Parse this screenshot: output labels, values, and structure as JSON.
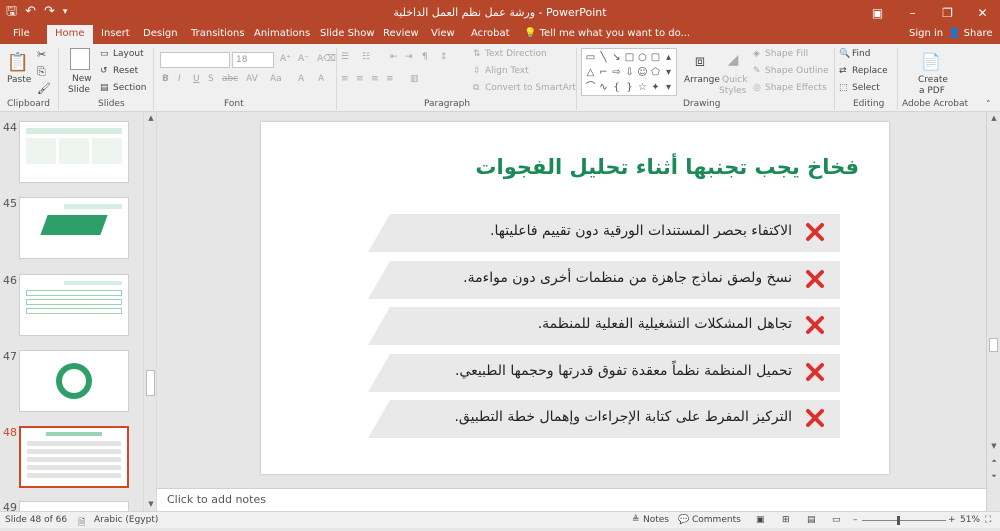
{
  "app": {
    "window_title": "ورشة عمل نظم العمل الداخلية  -  PowerPoint",
    "accent": "#b7472a"
  },
  "qat": {
    "save_icon": "save-icon",
    "undo_icon": "undo-icon",
    "redo_icon": "redo-icon",
    "customize_icon": "customize-icon"
  },
  "window_controls": {
    "ribbon_options": "▣",
    "minimize": "–",
    "restore": "❐",
    "close": "✕"
  },
  "tabs": [
    "File",
    "Home",
    "Insert",
    "Design",
    "Transitions",
    "Animations",
    "Slide Show",
    "Review",
    "View",
    "Acrobat"
  ],
  "tell_me": "Tell me what you want to do...",
  "account": {
    "sign_in": "Sign in",
    "share": "Share"
  },
  "ribbon": {
    "clipboard": {
      "paste": "Paste",
      "label": "Clipboard"
    },
    "slides": {
      "new_slide_1": "New",
      "new_slide_2": "Slide",
      "layout": "Layout",
      "reset": "Reset",
      "section": "Section",
      "label": "Slides"
    },
    "font": {
      "size": "18",
      "label": "Font",
      "bold": "B",
      "italic": "I",
      "underline": "U",
      "strike": "S",
      "shadow": "abc",
      "spacing": "AV",
      "case": "Aa",
      "highlight": "A",
      "color": "A"
    },
    "paragraph": {
      "text_direction": "Text Direction",
      "align_text": "Align Text",
      "convert_smartart": "Convert to SmartArt",
      "label": "Paragraph"
    },
    "drawing": {
      "arrange": "Arrange",
      "quick_styles_1": "Quick",
      "quick_styles_2": "Styles",
      "shape_fill": "Shape Fill",
      "shape_outline": "Shape Outline",
      "shape_effects": "Shape Effects",
      "label": "Drawing"
    },
    "editing": {
      "find": "Find",
      "replace": "Replace",
      "select": "Select",
      "label": "Editing"
    },
    "acrobat": {
      "create_pdf_1": "Create",
      "create_pdf_2": "a PDF",
      "label": "Adobe Acrobat"
    }
  },
  "thumbnails": [
    "44",
    "45",
    "46",
    "47",
    "48",
    "49"
  ],
  "slide": {
    "title": "فخاخ يجب تجنبها أثناء تحليل الفجوات",
    "title_color": "#1b8a57",
    "items": [
      "الاكتفاء بحصر المستندات الورقية دون تقييم فاعليتها.",
      "نسخ ولصق نماذج جاهزة من منظمات أخرى دون مواءمة.",
      "تجاهل المشكلات التشغيلية الفعلية للمنظمة.",
      "تحميل المنظمة نظماً معقدة تفوق قدرتها وحجمها الطبيعي.",
      "التركيز المفرط على كتابة الإجراءات وإهمال خطة التطبيق."
    ],
    "x_color": "#d9312c"
  },
  "notes_placeholder": "Click to add notes",
  "status": {
    "slide_pos": "Slide 48 of 66",
    "language": "Arabic (Egypt)",
    "notes": "Notes",
    "comments": "Comments",
    "zoom": "51%",
    "zoom_out": "–",
    "zoom_in": "+"
  }
}
